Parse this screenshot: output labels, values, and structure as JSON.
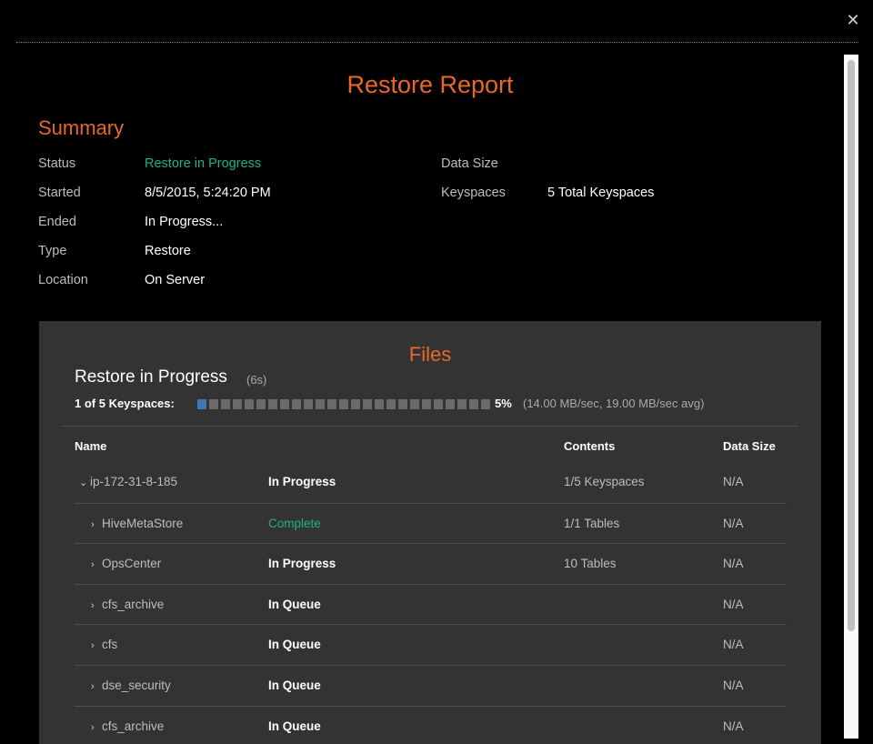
{
  "dialog": {
    "close_glyph": "✕"
  },
  "report": {
    "title": "Restore Report"
  },
  "summary": {
    "title": "Summary",
    "left": [
      {
        "label": "Status",
        "value": "Restore in Progress"
      },
      {
        "label": "Started",
        "value": "8/5/2015, 5:24:20 PM"
      },
      {
        "label": "Ended",
        "value": "In Progress..."
      },
      {
        "label": "Type",
        "value": "Restore"
      },
      {
        "label": "Location",
        "value": "On Server"
      }
    ],
    "right": [
      {
        "label": "Data Size",
        "value": ""
      },
      {
        "label": "Keyspaces",
        "value": "5 Total Keyspaces"
      }
    ]
  },
  "files": {
    "title": "Files",
    "progress_title": "Restore in Progress",
    "elapsed": "(6s)",
    "keyspaces_label": "1 of 5 Keyspaces:",
    "percent_text": "5%",
    "progress_fraction": 0.05,
    "rate": "(14.00 MB/sec, 19.00 MB/sec avg)",
    "columns": {
      "name": "Name",
      "contents": "Contents",
      "size": "Data Size"
    },
    "rows": [
      {
        "name": "ip-172-31-8-185",
        "status": "In Progress",
        "contents": "1/5 Keyspaces",
        "size": "N/A",
        "expanded": true,
        "level": 0
      },
      {
        "name": "HiveMetaStore",
        "status": "Complete",
        "contents": "1/1 Tables",
        "size": "N/A",
        "expanded": false,
        "level": 1
      },
      {
        "name": "OpsCenter",
        "status": "In Progress",
        "contents": "10 Tables",
        "size": "N/A",
        "expanded": false,
        "level": 1
      },
      {
        "name": "cfs_archive",
        "status": "In Queue",
        "contents": "",
        "size": "N/A",
        "expanded": false,
        "level": 1
      },
      {
        "name": "cfs",
        "status": "In Queue",
        "contents": "",
        "size": "N/A",
        "expanded": false,
        "level": 1
      },
      {
        "name": "dse_security",
        "status": "In Queue",
        "contents": "",
        "size": "N/A",
        "expanded": false,
        "level": 1
      },
      {
        "name": "cfs_archive",
        "status": "In Queue",
        "contents": "",
        "size": "N/A",
        "expanded": false,
        "level": 1
      }
    ]
  },
  "colors": {
    "accent": "#e8682c",
    "success": "#21b08c",
    "progress_fill": "#3d79b5",
    "panel_bg": "#333333"
  }
}
